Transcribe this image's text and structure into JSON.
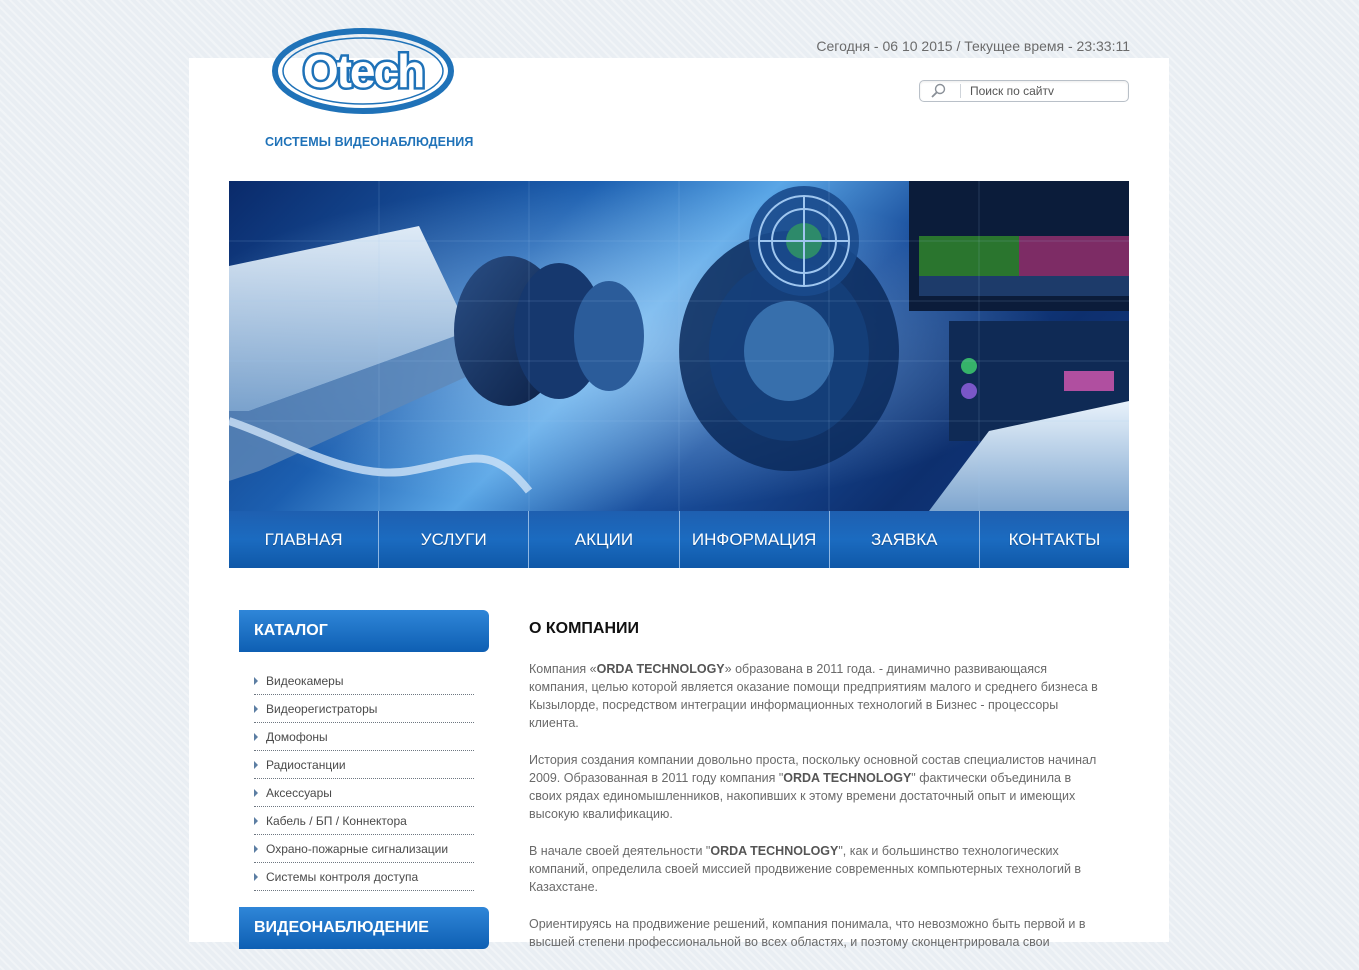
{
  "header": {
    "datetime": "Сегодня - 06 10 2015 / Текущее время - 23:33:11",
    "logo_text": "Otech",
    "tagline": "СИСТЕМЫ ВИДЕОНАБЛЮДЕНИЯ",
    "search_placeholder": "Поиск по сайтv"
  },
  "nav": {
    "items": [
      "ГЛАВНАЯ",
      "УСЛУГИ",
      "АКЦИИ",
      "ИНФОРМАЦИЯ",
      "ЗАЯВКА",
      "КОНТАКТЫ"
    ]
  },
  "sidebar": {
    "catalog_title": "КАТАЛОГ",
    "catalog_items": [
      "Видеокамеры",
      "Видеорегистраторы",
      "Домофоны",
      "Радиостанции",
      "Аксессуары",
      "Кабель / БП / Коннектора",
      "Охрано-пожарные сигнализации",
      "Системы контроля доступа"
    ],
    "second_title": "ВИДЕОНАБЛЮДЕНИЕ"
  },
  "content": {
    "title": "О КОМПАНИИ",
    "p1_pre": "Компания «",
    "p1_brand": "ORDA TECHNOLOGY",
    "p1_post": "» образована в 2011 года. - динамично развивающаяся компания, целью которой является оказание помощи предприятиям малого и среднего бизнеса в Кызылорде, посредством интеграции информационных технологий в Бизнес - процессоры клиента.",
    "p2_pre": "История создания компании довольно проста, поскольку основной состав специалистов начинал 2009. Образованная в 2011 году компания \"",
    "p2_brand": "ORDA TECHNOLOGY",
    "p2_post": "\" фактически объединила в своих рядах единомышленников, накопивших к этому времени достаточный опыт и имеющих высокую квалификацию.",
    "p3_pre": "В начале своей деятельности \"",
    "p3_brand": "ORDA TECHNOLOGY",
    "p3_post": "\", как и большинство технологических компаний, определила своей миссией продвижение современных компьютерных технологий в Казахстане.",
    "p4": "Ориентируясь на продвижение решений, компания понимала, что невозможно быть первой и в высшей степени профессиональной во всех областях, и поэтому сконцентрировала свои"
  },
  "colors": {
    "accent": "#1f72b8",
    "nav_bg": "#1b6bc0",
    "text": "#6a6a6a"
  },
  "icons": {
    "search": "magnifier-icon",
    "list_bullet": "triangle-right-icon"
  }
}
